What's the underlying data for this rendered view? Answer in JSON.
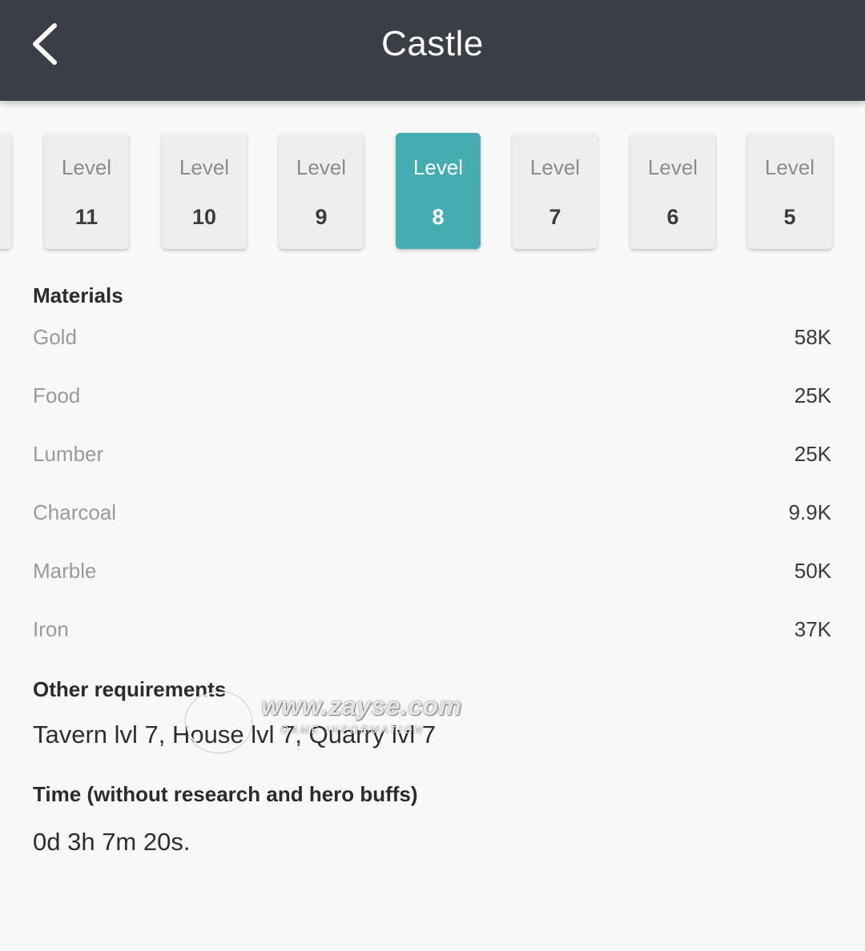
{
  "header": {
    "title": "Castle",
    "back_icon": "back-arrow-icon"
  },
  "levels": {
    "word": "Level",
    "selected": "8",
    "items": [
      {
        "number": "11"
      },
      {
        "number": "10"
      },
      {
        "number": "9"
      },
      {
        "number": "8"
      },
      {
        "number": "7"
      },
      {
        "number": "6"
      },
      {
        "number": "5"
      }
    ],
    "accent_color": "#45adb2"
  },
  "materials": {
    "heading": "Materials",
    "items": [
      {
        "name": "Gold",
        "value": "58K"
      },
      {
        "name": "Food",
        "value": "25K"
      },
      {
        "name": "Lumber",
        "value": "25K"
      },
      {
        "name": "Charcoal",
        "value": "9.9K"
      },
      {
        "name": "Marble",
        "value": "50K"
      },
      {
        "name": "Iron",
        "value": "37K"
      }
    ]
  },
  "requirements": {
    "heading": "Other requirements",
    "text": "Tavern lvl 7, House lvl 7, Quarry lvl 7"
  },
  "time": {
    "heading": "Time (without research and hero buffs)",
    "text": "0d 3h 7m 20s."
  },
  "watermark": {
    "url": "www.zayse.com",
    "subtitle": "GAME INFORMATION"
  },
  "colors": {
    "appbar": "#3a3e45",
    "background": "#f8f8f9"
  }
}
